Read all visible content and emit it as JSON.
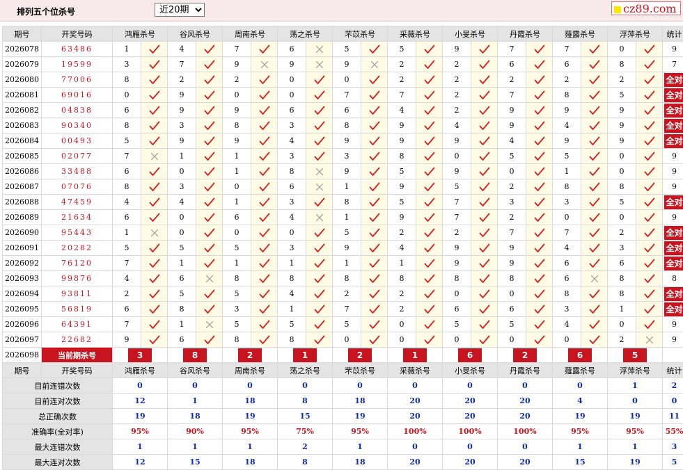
{
  "title": "排列五个位杀号",
  "period_select": {
    "selected": "近20期",
    "options": [
      "近20期"
    ]
  },
  "logo": {
    "text": "cz89.com"
  },
  "headers": [
    "期号",
    "开奖号码",
    "鸿雁杀号",
    "谷风杀号",
    "周南杀号",
    "荡之杀号",
    "芣苡杀号",
    "采薇杀号",
    "小旻杀号",
    "丹霞杀号",
    "薤露杀号",
    "浮萍杀号",
    "统计"
  ],
  "all_correct_label": "全对",
  "rows": [
    {
      "period": "2026078",
      "number": "63486",
      "kills": [
        1,
        4,
        7,
        6,
        5,
        5,
        9,
        7,
        7,
        0
      ],
      "marks": "yyyxyyyyyy",
      "total": "9"
    },
    {
      "period": "2026079",
      "number": "19599",
      "kills": [
        3,
        7,
        9,
        9,
        9,
        2,
        2,
        6,
        6,
        8
      ],
      "marks": "yyxxxyyyyy",
      "total": "7"
    },
    {
      "period": "2026080",
      "number": "77006",
      "kills": [
        8,
        2,
        2,
        0,
        0,
        2,
        2,
        2,
        2,
        2
      ],
      "marks": "yyyyyyyyyy",
      "total": "全对"
    },
    {
      "period": "2026081",
      "number": "69016",
      "kills": [
        0,
        9,
        0,
        0,
        7,
        7,
        2,
        7,
        8,
        5
      ],
      "marks": "yyyyyyyyyy",
      "total": "全对"
    },
    {
      "period": "2026082",
      "number": "04838",
      "kills": [
        6,
        9,
        9,
        6,
        6,
        4,
        2,
        9,
        9,
        9
      ],
      "marks": "yyyyyyyyyy",
      "total": "全对"
    },
    {
      "period": "2026083",
      "number": "90340",
      "kills": [
        8,
        3,
        8,
        3,
        8,
        9,
        4,
        9,
        4,
        9
      ],
      "marks": "yyyyyyyyyy",
      "total": "全对"
    },
    {
      "period": "2026084",
      "number": "00493",
      "kills": [
        5,
        9,
        9,
        4,
        9,
        9,
        9,
        4,
        9,
        9
      ],
      "marks": "yyyyyyyyyy",
      "total": "全对"
    },
    {
      "period": "2026085",
      "number": "02077",
      "kills": [
        7,
        1,
        1,
        3,
        3,
        8,
        0,
        5,
        5,
        0
      ],
      "marks": "xyyyyyyyyy",
      "total": "9"
    },
    {
      "period": "2026086",
      "number": "33488",
      "kills": [
        6,
        0,
        1,
        8,
        9,
        5,
        9,
        0,
        1,
        0
      ],
      "marks": "yyyxyyyyyy",
      "total": "9"
    },
    {
      "period": "2026087",
      "number": "07076",
      "kills": [
        8,
        3,
        0,
        6,
        1,
        9,
        5,
        2,
        8,
        8
      ],
      "marks": "yyyxyyyyyy",
      "total": "9"
    },
    {
      "period": "2026088",
      "number": "47459",
      "kills": [
        4,
        4,
        1,
        3,
        8,
        5,
        7,
        3,
        3,
        5
      ],
      "marks": "yyyyyyyyyy",
      "total": "全对"
    },
    {
      "period": "2026089",
      "number": "21634",
      "kills": [
        6,
        0,
        6,
        4,
        1,
        9,
        7,
        2,
        0,
        0
      ],
      "marks": "yyyxyyyyyy",
      "total": "9"
    },
    {
      "period": "2026090",
      "number": "95443",
      "kills": [
        1,
        0,
        0,
        0,
        5,
        2,
        2,
        7,
        7,
        2
      ],
      "marks": "xyyyyyyyyy",
      "total": "全对"
    },
    {
      "period": "2026091",
      "number": "20282",
      "kills": [
        5,
        5,
        5,
        3,
        9,
        4,
        9,
        9,
        4,
        3
      ],
      "marks": "yyyyyyyyyy",
      "total": "全对"
    },
    {
      "period": "2026092",
      "number": "76120",
      "kills": [
        7,
        1,
        1,
        1,
        1,
        1,
        9,
        9,
        6,
        6
      ],
      "marks": "yyyyyyyyyy",
      "total": "全对"
    },
    {
      "period": "2026093",
      "number": "99876",
      "kills": [
        4,
        6,
        8,
        8,
        8,
        8,
        8,
        8,
        6,
        8
      ],
      "marks": "yxyyyyyyxy",
      "total": "8"
    },
    {
      "period": "2026094",
      "number": "93811",
      "kills": [
        2,
        5,
        5,
        4,
        2,
        2,
        0,
        0,
        8,
        8
      ],
      "marks": "yyyyyyyyyy",
      "total": "全对"
    },
    {
      "period": "2026095",
      "number": "56819",
      "kills": [
        6,
        8,
        3,
        1,
        7,
        2,
        6,
        6,
        3,
        1
      ],
      "marks": "yyyyyyyyyy",
      "total": "全对"
    },
    {
      "period": "2026096",
      "number": "64391",
      "kills": [
        7,
        1,
        5,
        5,
        5,
        0,
        5,
        5,
        4,
        0
      ],
      "marks": "yxyyyyyyyy",
      "total": "9"
    },
    {
      "period": "2026097",
      "number": "22682",
      "kills": [
        9,
        6,
        8,
        8,
        0,
        0,
        0,
        0,
        0,
        2
      ],
      "marks": "yyyyyyyyyx",
      "total": "9"
    }
  ],
  "current": {
    "period": "2026098",
    "label": "当前期杀号",
    "kills": [
      3,
      8,
      2,
      1,
      2,
      1,
      6,
      2,
      6,
      5
    ]
  },
  "stats": [
    {
      "label": "目前连错次数",
      "values": [
        "0",
        "0",
        "0",
        "0",
        "0",
        "0",
        "0",
        "0",
        "0",
        "1",
        "2"
      ],
      "red": false
    },
    {
      "label": "目前连对次数",
      "values": [
        "12",
        "1",
        "18",
        "8",
        "18",
        "20",
        "20",
        "20",
        "4",
        "0",
        "0"
      ],
      "red": false
    },
    {
      "label": "总正确次数",
      "values": [
        "19",
        "18",
        "19",
        "15",
        "19",
        "20",
        "20",
        "20",
        "19",
        "19",
        "11"
      ],
      "red": false
    },
    {
      "label": "准确率(全对率)",
      "values": [
        "95%",
        "90%",
        "95%",
        "75%",
        "95%",
        "100%",
        "100%",
        "100%",
        "95%",
        "95%",
        "55%"
      ],
      "red": true
    },
    {
      "label": "最大连错次数",
      "values": [
        "1",
        "1",
        "1",
        "2",
        "1",
        "0",
        "0",
        "0",
        "1",
        "1",
        "3"
      ],
      "red": false
    },
    {
      "label": "最大连对次数",
      "values": [
        "12",
        "15",
        "18",
        "8",
        "18",
        "20",
        "20",
        "20",
        "15",
        "19",
        "5"
      ],
      "red": false
    }
  ],
  "colors": {
    "accent": "#c8141e",
    "stat_blue": "#0d2ab0",
    "header_bg": "#e4e4e4",
    "mark_bg": "#fffbe5",
    "top_bg": "#f8e9ea"
  }
}
